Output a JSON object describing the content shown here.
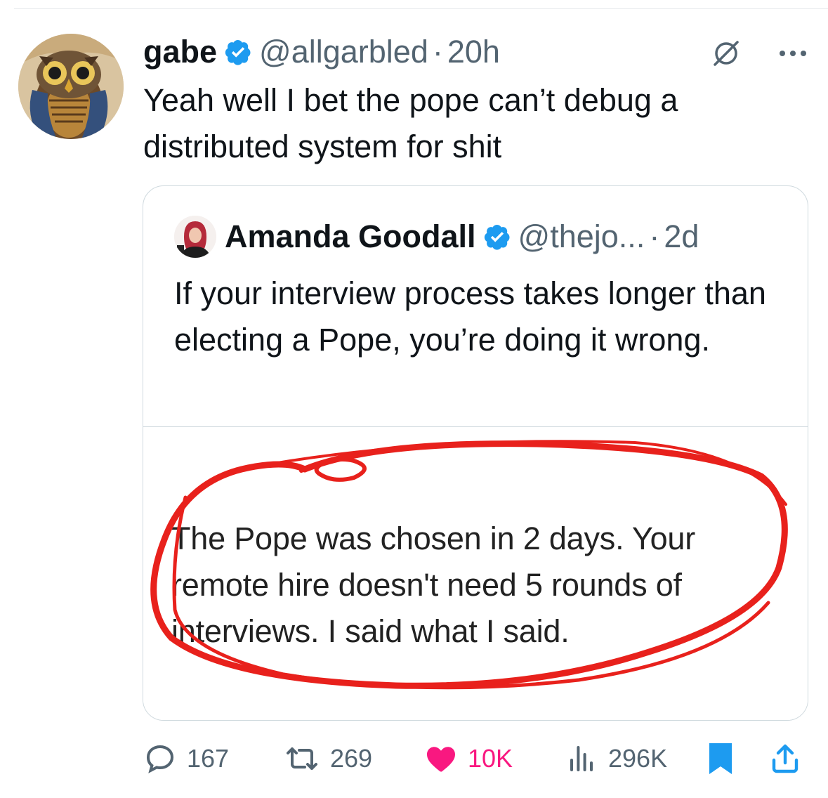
{
  "tweet": {
    "author_name": "gabe",
    "handle": "@allgarbled",
    "separator": "·",
    "time": "20h",
    "text": "Yeah well I bet the pope can’t debug a distributed system for shit"
  },
  "quote": {
    "author_name": "Amanda Goodall",
    "handle": "@thejo...",
    "separator": "·",
    "time": "2d",
    "text": "If your interview process takes longer than electing a Pope, you’re doing it wrong.",
    "media_text": "The Pope was chosen in 2 days. Your remote hire doesn't need 5 rounds of interviews. I said what I said."
  },
  "actions": {
    "replies": "167",
    "reposts": "269",
    "likes": "10K",
    "views": "296K"
  },
  "colors": {
    "verified": "#1d9bf0",
    "like": "#f91880",
    "bookmark": "#1d9bf0",
    "share": "#1d9bf0",
    "scribble": "#e8211c"
  }
}
